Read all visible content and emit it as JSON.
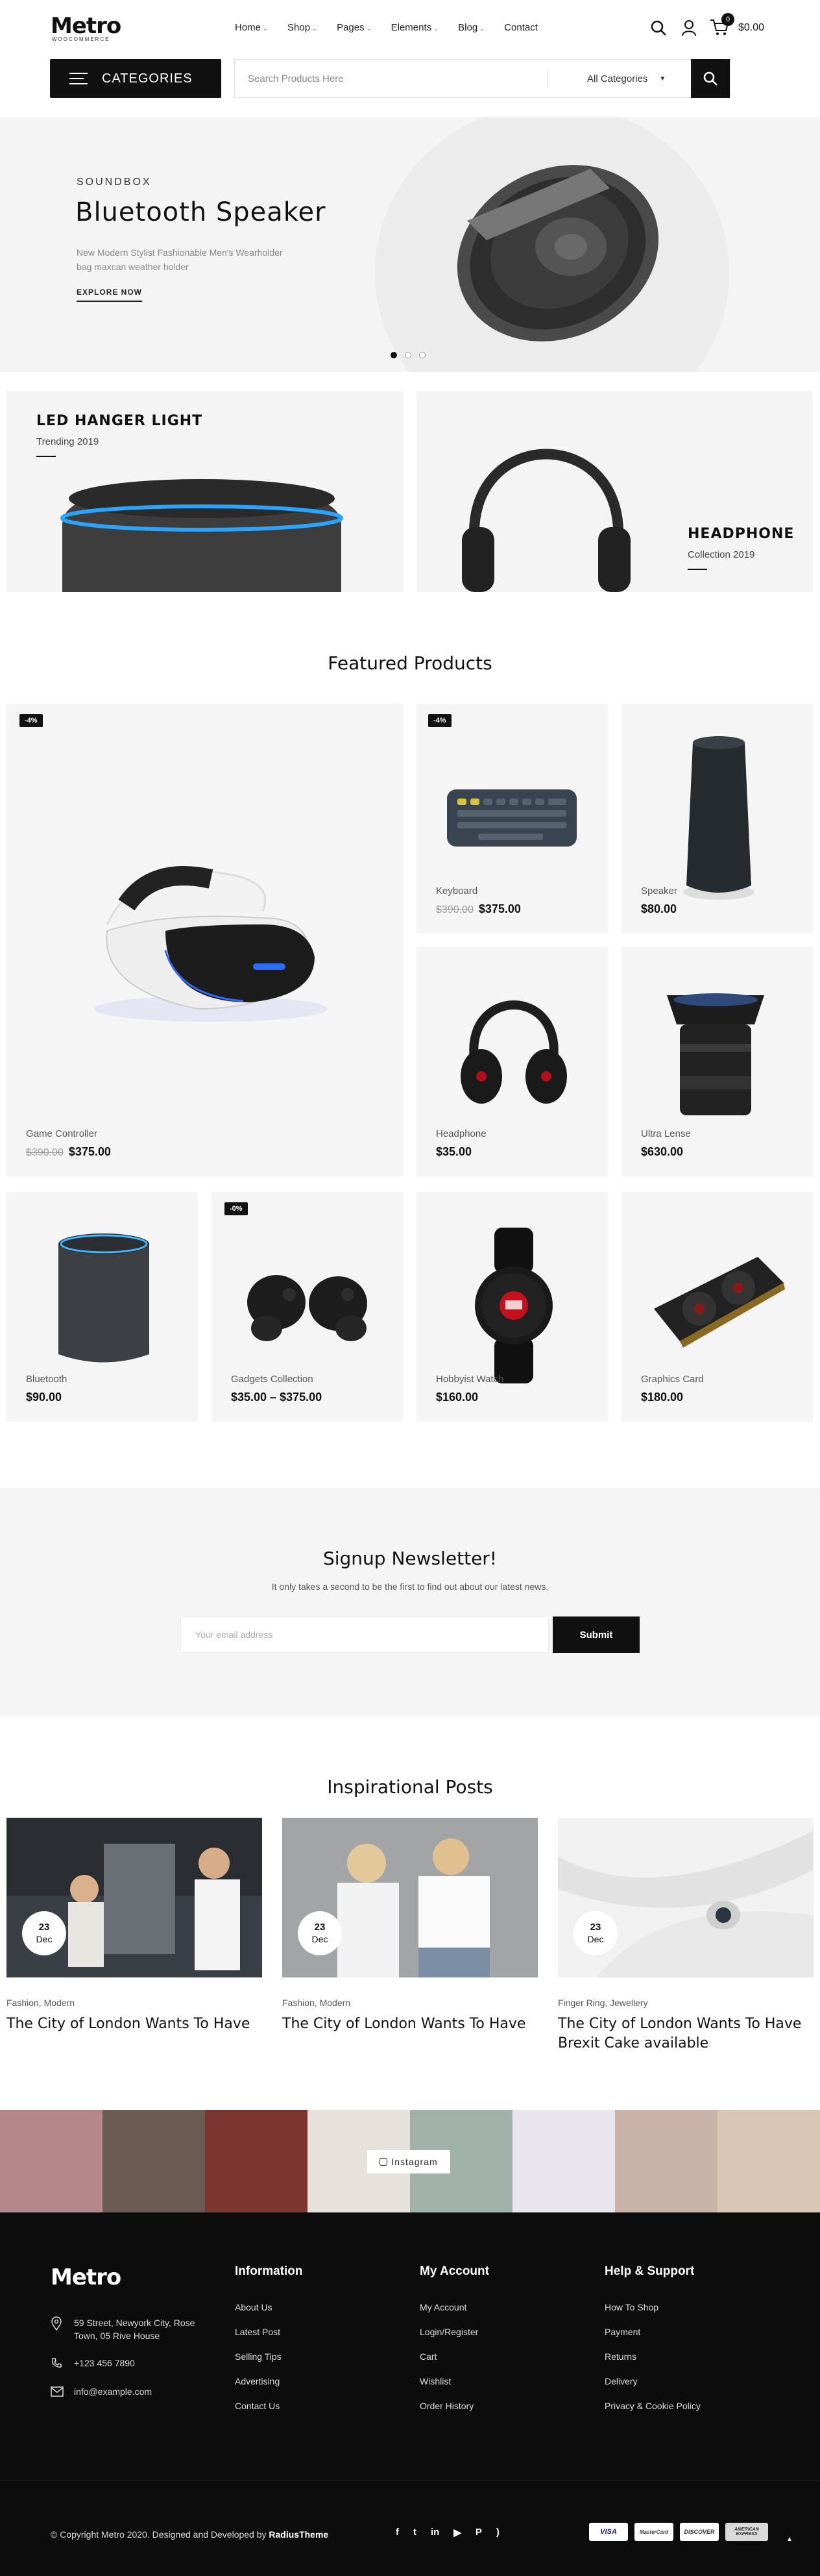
{
  "header": {
    "logo": "Metro",
    "logo_sub": "WOOCOMMERCE",
    "nav": [
      "Home",
      "Shop",
      "Pages",
      "Elements",
      "Blog",
      "Contact"
    ],
    "cart_count": "0",
    "cart_total": "$0.00",
    "categories_label": "CATEGORIES",
    "search_placeholder": "Search Products Here",
    "search_category": "All Categories"
  },
  "hero": {
    "kicker": "SOUNDBOX",
    "title": "Bluetooth Speaker",
    "desc_line1": "New Modern Stylist Fashionable Men's Wearholder",
    "desc_line2": "bag maxcan weather holder",
    "cta": "EXPLORE NOW",
    "slides": 3,
    "active_slide": 1
  },
  "banners": [
    {
      "title": "LED HANGER LIGHT",
      "sub": "Trending 2019"
    },
    {
      "title": "HEADPHONE",
      "sub": "Collection 2019"
    }
  ],
  "featured": {
    "title": "Featured Products",
    "products": [
      {
        "name": "Game Controller",
        "old": "$390.00",
        "price": "$375.00",
        "badge": "-4%"
      },
      {
        "name": "Keyboard",
        "old": "$390.00",
        "price": "$375.00",
        "badge": "-4%"
      },
      {
        "name": "Speaker",
        "old": "",
        "price": "$80.00",
        "badge": ""
      },
      {
        "name": "Headphone",
        "old": "",
        "price": "$35.00",
        "badge": ""
      },
      {
        "name": "Ultra Lense",
        "old": "",
        "price": "$630.00",
        "badge": ""
      },
      {
        "name": "Bluetooth",
        "old": "",
        "price": "$90.00",
        "badge": ""
      },
      {
        "name": "Gadgets Collection",
        "old": "",
        "price": "$35.00 – $375.00",
        "badge": "-0%"
      },
      {
        "name": "Hobbyist Watch",
        "old": "",
        "price": "$160.00",
        "badge": ""
      },
      {
        "name": "Graphics Card",
        "old": "",
        "price": "$180.00",
        "badge": ""
      }
    ]
  },
  "newsletter": {
    "title": "Signup Newsletter!",
    "sub": "It only takes a second to be the first to find out about our latest news.",
    "placeholder": "Your email address",
    "button": "Submit"
  },
  "posts": {
    "title": "Inspirational Posts",
    "items": [
      {
        "day": "23",
        "month": "Dec",
        "cat": "Fashion, Modern",
        "title": "The City of London Wants To Have",
        "title2": ""
      },
      {
        "day": "23",
        "month": "Dec",
        "cat": "Fashion, Modern",
        "title": "The City of London Wants To Have",
        "title2": ""
      },
      {
        "day": "23",
        "month": "Dec",
        "cat": "Finger Ring, Jewellery",
        "title": "The City of London Wants To Have",
        "title2": "Brexit Cake available"
      }
    ]
  },
  "instagram": {
    "label": "Instagram"
  },
  "footer": {
    "logo": "Metro",
    "address_line1": "59 Street, Newyork City, Rose",
    "address_line2": "Town, 05 Rive House",
    "phone": "+123 456 7890",
    "email": "info@example.com",
    "columns": [
      {
        "head": "Information",
        "links": [
          "About Us",
          "Latest Post",
          "Selling Tips",
          "Advertising",
          "Contact Us"
        ]
      },
      {
        "head": "My Account",
        "links": [
          "My Account",
          "Login/Register",
          "Cart",
          "Wishlist",
          "Order History"
        ]
      },
      {
        "head": "Help & Support",
        "links": [
          "How To Shop",
          "Payment",
          "Returns",
          "Delivery",
          "Privacy & Cookie Policy"
        ]
      }
    ],
    "copyright": "© Copyright Metro 2020. Designed and Developed by",
    "copyright_brand": "RadiusTheme",
    "payments": [
      "VISA",
      "MasterCard",
      "DISCOVER",
      "AMERICAN EXPRESS"
    ]
  },
  "colors": {
    "accent": "#111111",
    "panel": "#f4f4f4",
    "footer": "#0c0c0c"
  }
}
